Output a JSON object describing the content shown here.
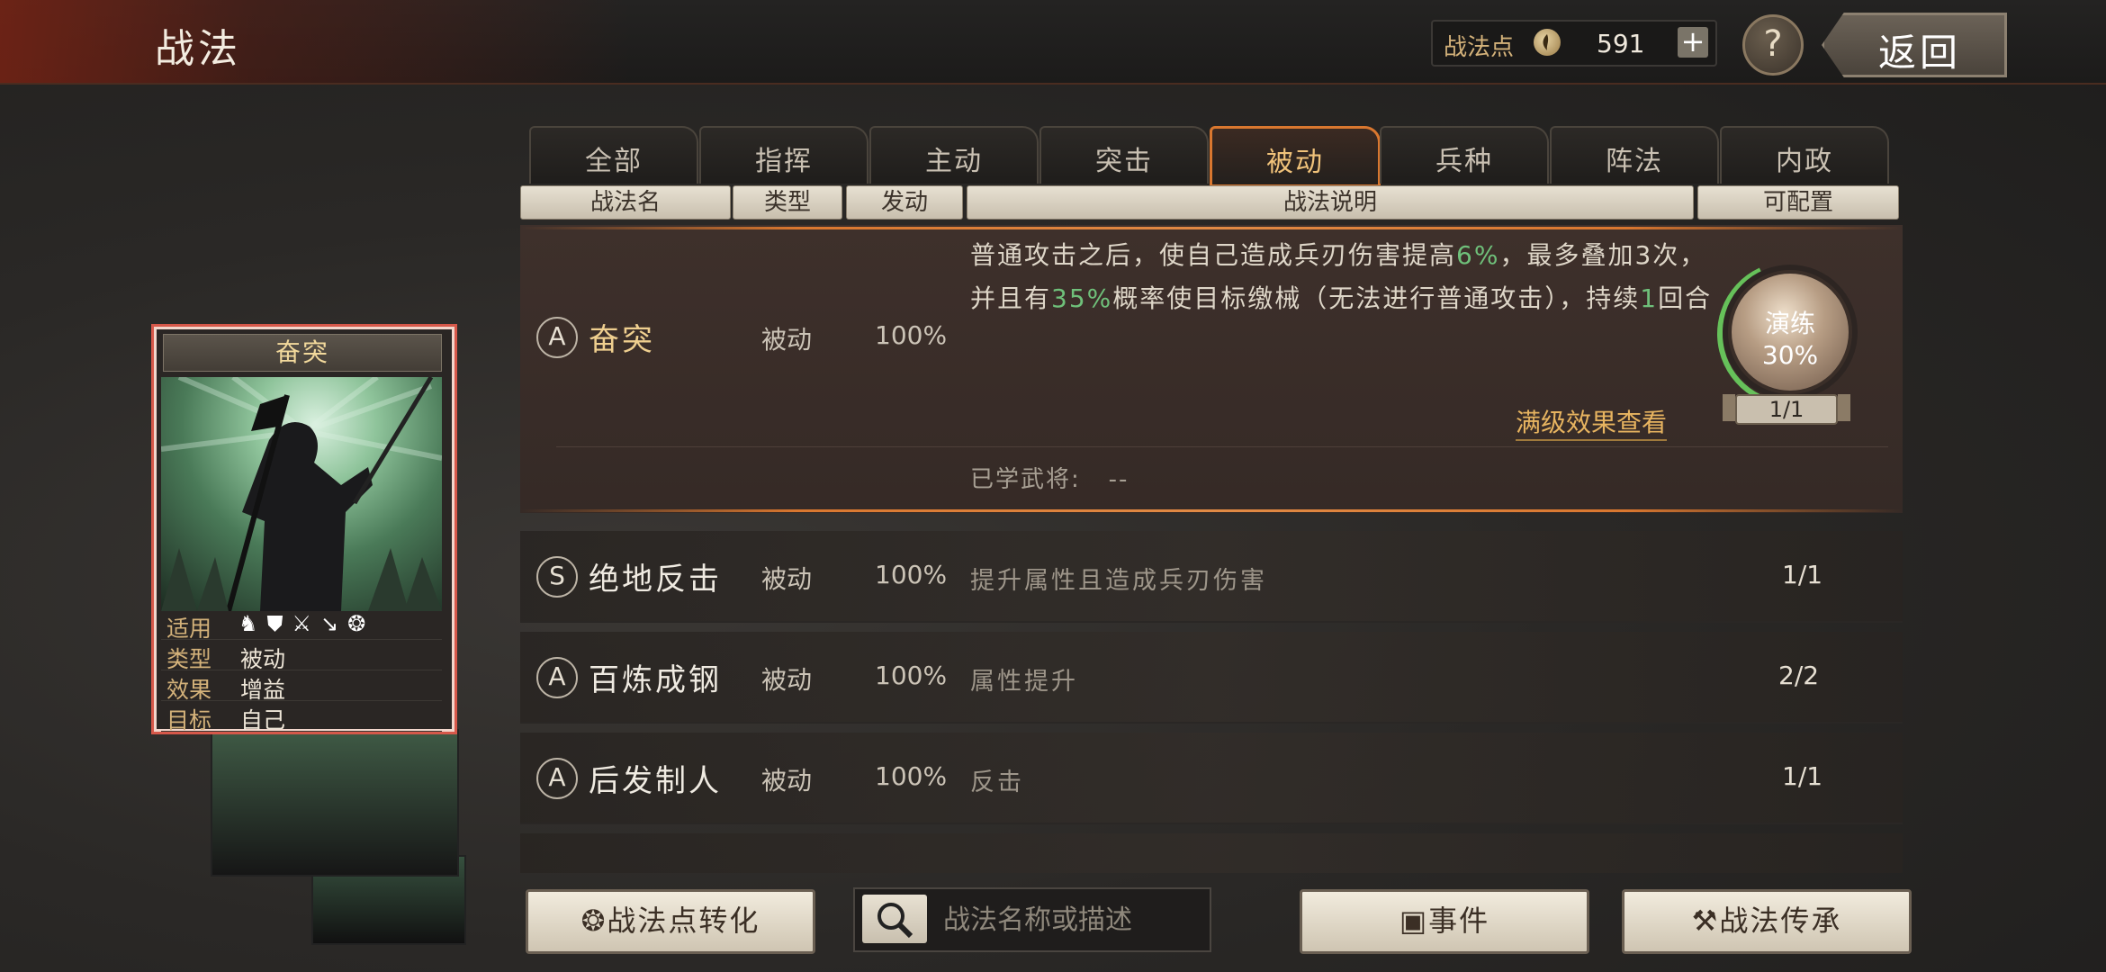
{
  "header": {
    "title": "战法",
    "points_label": "战法点",
    "points_value": "591",
    "add_label": "+",
    "help_label": "?",
    "back_label": "返回"
  },
  "tabs": [
    {
      "label": "全部"
    },
    {
      "label": "指挥"
    },
    {
      "label": "主动"
    },
    {
      "label": "突击"
    },
    {
      "label": "被动",
      "active": true
    },
    {
      "label": "兵种"
    },
    {
      "label": "阵法"
    },
    {
      "label": "内政"
    }
  ],
  "columns": {
    "name": "战法名",
    "type": "类型",
    "trigger": "发动",
    "desc": "战法说明",
    "config": "可配置"
  },
  "selected": {
    "grade": "A",
    "name": "奋突",
    "type": "被动",
    "rate": "100%",
    "desc_parts": [
      "普通攻击之后，使自己造成兵刃伤害提高",
      "6%",
      "，最多叠加3次，并且有",
      "35%",
      "概率使目标缴械（无法进行普通攻击），持续",
      "1",
      "回合"
    ],
    "max_effect_link": "满级效果查看",
    "learned_label": "已学武将:",
    "learned_value": "--",
    "drill_label": "演练",
    "drill_percent": "30%",
    "drill_count": "1/1"
  },
  "rows": [
    {
      "grade": "S",
      "name": "绝地反击",
      "type": "被动",
      "rate": "100%",
      "desc": "提升属性且造成兵刃伤害",
      "config": "1/1"
    },
    {
      "grade": "A",
      "name": "百炼成钢",
      "type": "被动",
      "rate": "100%",
      "desc": "属性提升",
      "config": "2/2"
    },
    {
      "grade": "A",
      "name": "后发制人",
      "type": "被动",
      "rate": "100%",
      "desc": "反击",
      "config": "1/1"
    }
  ],
  "card": {
    "title": "奋突",
    "props": [
      {
        "key": "适用",
        "icons": [
          "cavalry-icon",
          "shield-icon",
          "bow-icon",
          "spear-icon",
          "wheel-icon"
        ]
      },
      {
        "key": "类型",
        "value": "被动"
      },
      {
        "key": "效果",
        "value": "增益"
      },
      {
        "key": "目标",
        "value": "自己"
      }
    ]
  },
  "bottom": {
    "convert_label": "战法点转化",
    "search_placeholder": "战法名称或描述",
    "events_label": "事件",
    "inherit_label": "战法传承"
  },
  "colors": {
    "accent": "#d9772f",
    "highlight_text": "#6fc07a",
    "gold_text": "#e7b460"
  }
}
